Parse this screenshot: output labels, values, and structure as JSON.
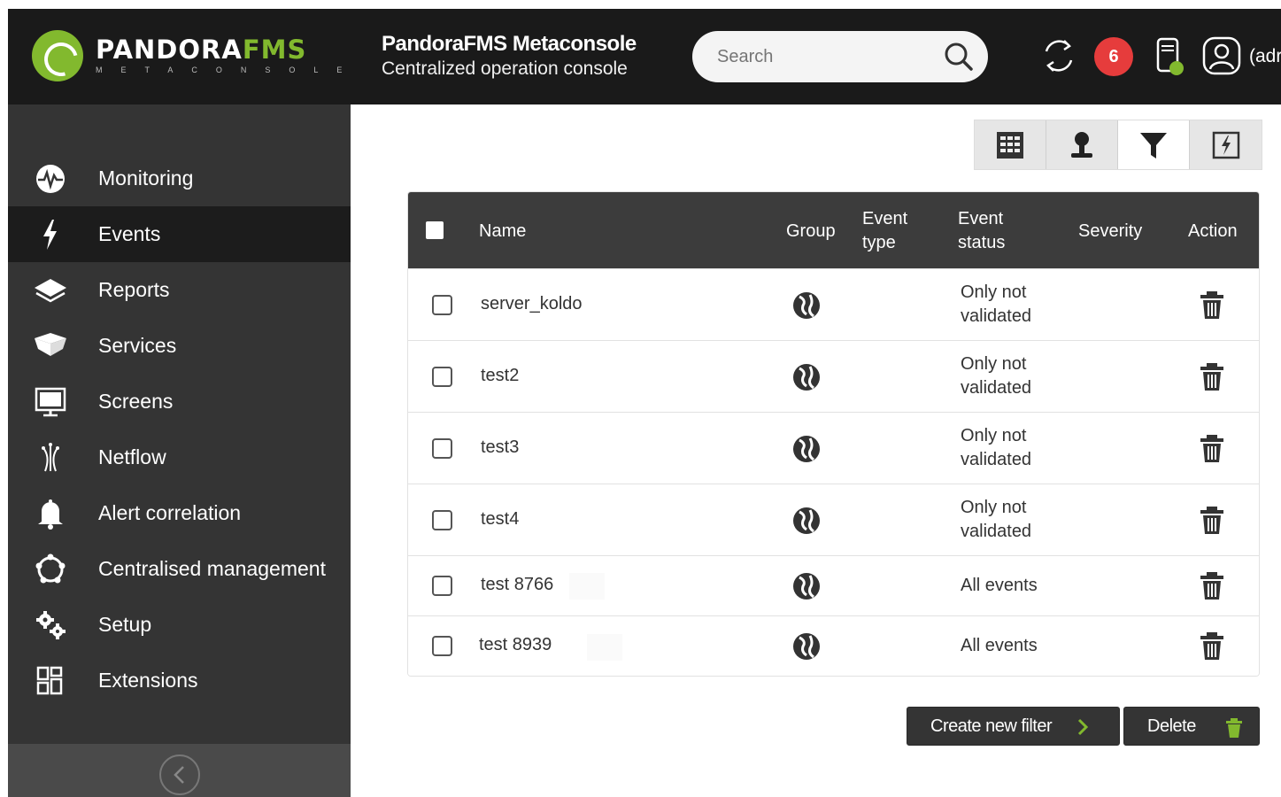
{
  "header": {
    "logo_text_main": "PANDORA",
    "logo_text_accent": "FMS",
    "logo_subtext": "METACONSOLE",
    "title": "PandoraFMS Metaconsole",
    "subtitle": "Centralized operation console",
    "search_placeholder": "Search",
    "notification_count": "6",
    "user_label": "(adr"
  },
  "sidebar": {
    "items": [
      {
        "label": "Monitoring",
        "icon": "monitoring-icon"
      },
      {
        "label": "Events",
        "icon": "lightning-icon",
        "active": true
      },
      {
        "label": "Reports",
        "icon": "reports-icon"
      },
      {
        "label": "Services",
        "icon": "services-icon"
      },
      {
        "label": "Screens",
        "icon": "monitor-icon"
      },
      {
        "label": "Netflow",
        "icon": "netflow-icon"
      },
      {
        "label": "Alert correlation",
        "icon": "bell-icon"
      },
      {
        "label": "Centralised management",
        "icon": "centralised-icon"
      },
      {
        "label": "Setup",
        "icon": "gears-icon"
      },
      {
        "label": "Extensions",
        "icon": "extensions-icon"
      }
    ]
  },
  "tabs": [
    "columns-icon",
    "user-icon",
    "filter-icon",
    "event-icon"
  ],
  "table": {
    "columns": {
      "name": "Name",
      "group": "Group",
      "event_type_1": "Event",
      "event_type_2": "type",
      "event_status_1": "Event",
      "event_status_2": "status",
      "severity": "Severity",
      "action": "Action"
    },
    "rows": [
      {
        "name": "server_koldo",
        "status_1": "Only not",
        "status_2": "validated"
      },
      {
        "name": "test2",
        "status_1": "Only not",
        "status_2": "validated"
      },
      {
        "name": "test3",
        "status_1": "Only not",
        "status_2": "validated"
      },
      {
        "name": "test4",
        "status_1": "Only not",
        "status_2": "validated"
      },
      {
        "name": "test 8766",
        "status_1": "All events",
        "status_2": ""
      },
      {
        "name": "test 8939",
        "status_1": "All events",
        "status_2": ""
      }
    ]
  },
  "buttons": {
    "create": "Create new filter",
    "delete": "Delete"
  },
  "colors": {
    "brand_green": "#82b92e",
    "header_bg": "#1a1a1a",
    "sidebar_bg": "#343434",
    "badge_red": "#e63c3c"
  }
}
